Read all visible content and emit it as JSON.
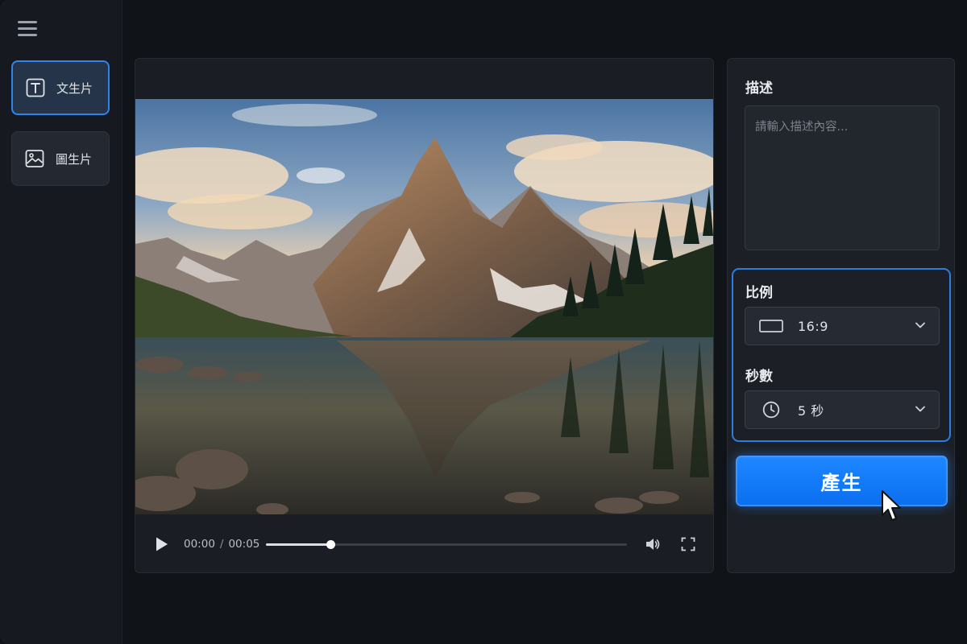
{
  "sidebar": {
    "items": [
      {
        "label": "文生片",
        "icon": "text-icon",
        "active": true
      },
      {
        "label": "圖生片",
        "icon": "image-icon",
        "active": false
      }
    ]
  },
  "player": {
    "current_time": "00:00",
    "separator": "/",
    "duration": "00:05",
    "progress_fraction": 0.18
  },
  "form": {
    "description_label": "描述",
    "description_placeholder": "請輸入描述內容...",
    "ratio_label": "比例",
    "ratio_value": "16:9",
    "seconds_label": "秒數",
    "seconds_value": "5 秒",
    "generate_label": "產生"
  },
  "colors": {
    "accent": "#1e87ff",
    "panel": "#1c2026",
    "background": "#101317"
  }
}
